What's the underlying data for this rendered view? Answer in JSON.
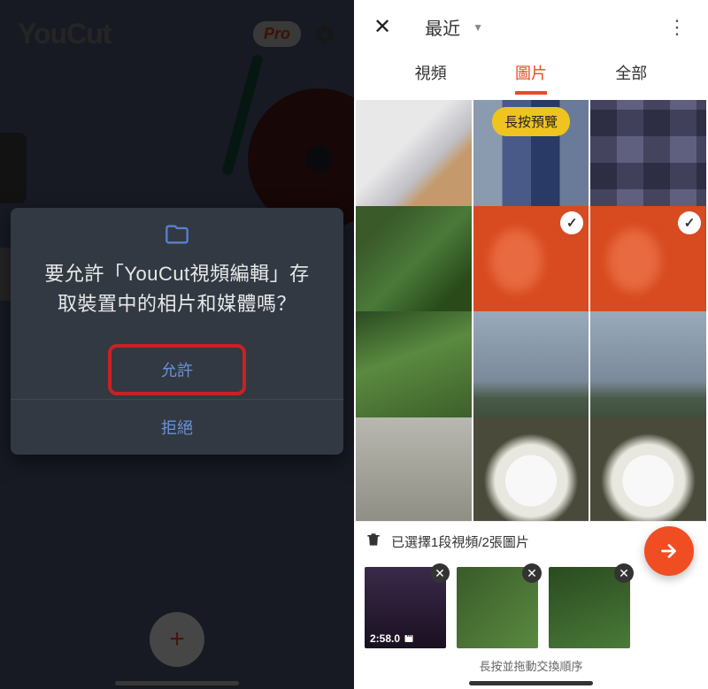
{
  "left": {
    "app_name": "YouCut",
    "pro_label": "Pro",
    "dialog": {
      "message": "要允許「YouCut視頻編輯」存取裝置中的相片和媒體嗎？",
      "allow": "允許",
      "deny": "拒絕"
    },
    "fab_add": "+"
  },
  "right": {
    "title": "最近",
    "tabs": {
      "video": "視頻",
      "image": "圖片",
      "all": "全部"
    },
    "long_press_hint": "長按預覽",
    "selection_text": "已選擇1段視頻/2張圖片",
    "drag_hint": "長按並拖動交換順序",
    "sel_duration": "2:58.0",
    "grid": [
      {
        "name": "thumb-gundam",
        "class": "t-gundam",
        "hint": false,
        "check": false
      },
      {
        "name": "thumb-pixel-a",
        "class": "t-pixel",
        "hint": true,
        "check": false
      },
      {
        "name": "thumb-pixel-b",
        "class": "t-pixel2",
        "hint": false,
        "check": false
      },
      {
        "name": "thumb-plant-a",
        "class": "t-plant",
        "hint": false,
        "check": false
      },
      {
        "name": "thumb-orange-a",
        "class": "t-orange",
        "hint": false,
        "check": true
      },
      {
        "name": "thumb-orange-b",
        "class": "t-orange",
        "hint": false,
        "check": true
      },
      {
        "name": "thumb-plant-b",
        "class": "t-plant2",
        "hint": false,
        "check": false
      },
      {
        "name": "thumb-sky-a",
        "class": "t-sky",
        "hint": false,
        "check": false
      },
      {
        "name": "thumb-sky-b",
        "class": "t-sky",
        "hint": false,
        "check": false
      },
      {
        "name": "thumb-cloud",
        "class": "t-cloud",
        "hint": false,
        "check": false
      },
      {
        "name": "thumb-flower-a",
        "class": "t-flower",
        "hint": false,
        "check": false
      },
      {
        "name": "thumb-flower-b",
        "class": "t-flower",
        "hint": false,
        "check": false
      }
    ]
  }
}
